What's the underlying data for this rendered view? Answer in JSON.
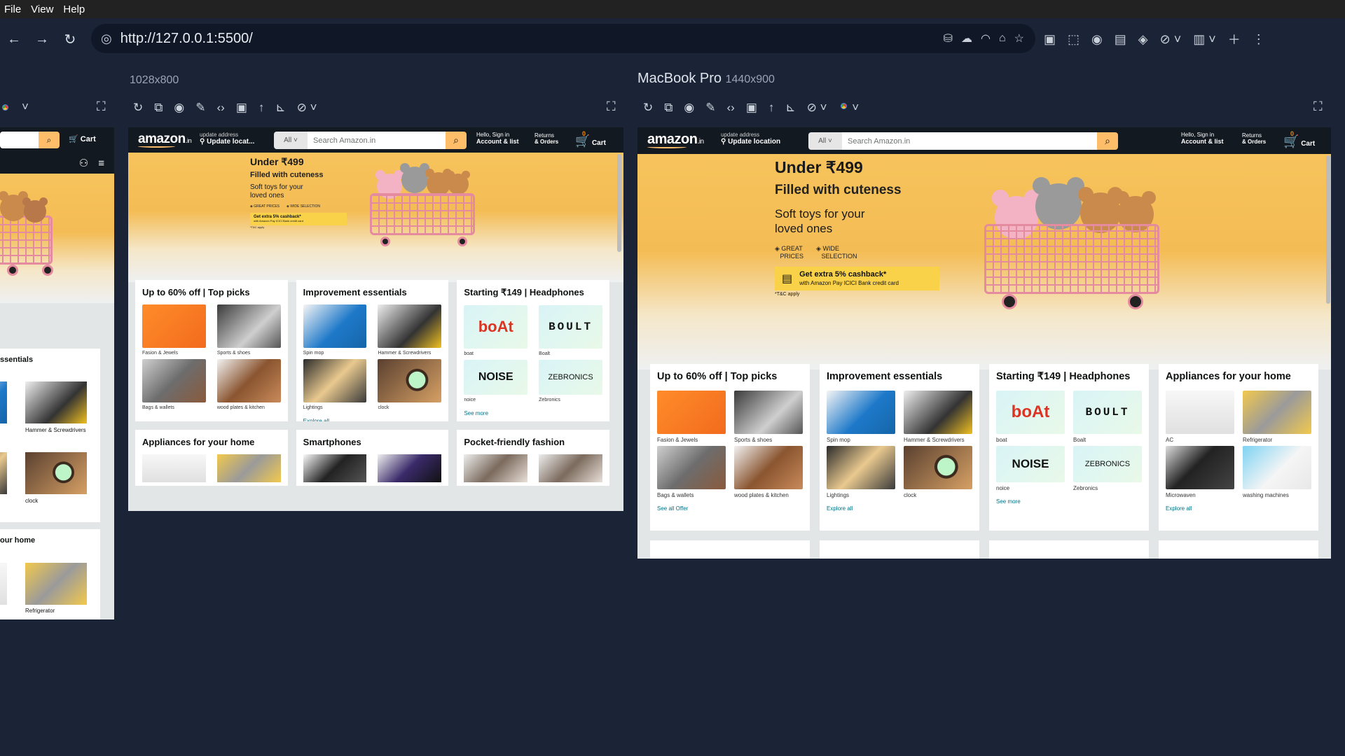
{
  "menubar": {
    "items": [
      "File",
      "View",
      "Help"
    ]
  },
  "toolbar": {
    "url": "http://127.0.0.1:5500/"
  },
  "left_device": {
    "label": ""
  },
  "device_1028": {
    "label": "1028x800"
  },
  "device_mac": {
    "name": "MacBook Pro",
    "size": "1440x900"
  },
  "amazon": {
    "logo": "amazon",
    "logo_suffix": ".in",
    "address_line1": "update address",
    "address_line2_short": "Update locat...",
    "address_line2": "Update location",
    "search_category": "All",
    "search_placeholder": "Search Amazon.in",
    "account_line1": "Hello, Sign in",
    "account_line2": "Account & list",
    "returns_line1": "Returns",
    "returns_line2": "& Orders",
    "cart_count": "0",
    "cart_label": "Cart"
  },
  "hero": {
    "title": "Under ₹499",
    "subtitle": "Filled with cuteness",
    "line1": "Soft toys for your",
    "line2": "loved ones",
    "badge1a": "GREAT",
    "badge1b": "PRICES",
    "badge2a": "WIDE",
    "badge2b": "SELECTION",
    "cashback_title": "Get extra 5% cashback*",
    "cashback_sub": "with Amazon Pay ICICI Bank credit card",
    "tnc": "*T&C apply"
  },
  "cards": {
    "top_picks": {
      "title": "Up to 60% off | Top picks",
      "items": [
        "Fasion & Jewels",
        "Sports & shoes",
        "Bags & wallets",
        "wood plates & kitchen"
      ],
      "link": "See all Offer"
    },
    "improvement": {
      "title": "Improvement essentials",
      "items": [
        "Spin mop",
        "Hammer & Screwdrivers",
        "Lightings",
        "clock"
      ],
      "link": "Explore all"
    },
    "headphones": {
      "title": "Starting ₹149 | Headphones",
      "items": [
        "boat",
        "Boalt",
        "noice",
        "Zebronics"
      ],
      "brands": [
        "boAt",
        "BOULT",
        "NOISE",
        "ZEBRONICS"
      ],
      "link": "See more"
    },
    "appliances": {
      "title": "Appliances for your home",
      "items": [
        "AC",
        "Refrigerator",
        "Microwaven",
        "washing machines"
      ],
      "link": "Explore all"
    },
    "smartphones": {
      "title": "Smartphones"
    },
    "fashion": {
      "title": "Pocket-friendly fashion"
    }
  },
  "left_partial": {
    "cart_label": "Cart",
    "card1_title": "ssentials",
    "card1_items": [
      "Hammer & Screwdrivers",
      "clock"
    ],
    "card2_title": "our home",
    "card2_items": [
      "Refrigerator"
    ]
  }
}
